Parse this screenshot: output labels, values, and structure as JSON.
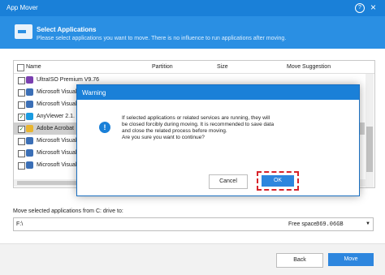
{
  "window": {
    "title": "App Mover",
    "help_label": "?",
    "close_label": "×"
  },
  "header": {
    "title": "Select Applications",
    "subtitle": "Please select applications you want to move. There is no influence to run applications after moving."
  },
  "table": {
    "columns": [
      "Name",
      "Partition",
      "Size",
      "Move Suggestion"
    ],
    "rows": [
      {
        "name": "UltraISO Premium V9.76",
        "checked": false,
        "icon_color": "#7a3fb0"
      },
      {
        "name": "Microsoft Visual",
        "checked": false,
        "icon_color": "#3b6fb6"
      },
      {
        "name": "Microsoft Visual",
        "checked": false,
        "icon_color": "#3b6fb6"
      },
      {
        "name": "AnyViewer 2.1.",
        "checked": true,
        "icon_color": "#1a9be0"
      },
      {
        "name": "Adobe Acrobat",
        "checked": true,
        "icon_color": "#e8b530",
        "selected": true
      },
      {
        "name": "Microsoft Visual",
        "checked": false,
        "icon_color": "#3b6fb6"
      },
      {
        "name": "Microsoft Visual",
        "checked": false,
        "icon_color": "#3b6fb6"
      },
      {
        "name": "Microsoft Visual",
        "checked": false,
        "icon_color": "#3b6fb6"
      }
    ]
  },
  "drive": {
    "label": "Move selected applications from C: drive to:",
    "path": "F:\\",
    "free_label": "Free space:",
    "free_value": "369.06GB"
  },
  "footer": {
    "back_label": "Back",
    "move_label": "Move"
  },
  "dialog": {
    "title": "Warning",
    "icon_label": "!",
    "line1": "If selected applications or related services are running, they will",
    "line2": "be closed forcibly during moving. It is recommended to save data",
    "line3": "and close the related process before moving.",
    "line4": "Are you sure you want to continue?",
    "cancel_label": "Cancel",
    "ok_label": "OK"
  },
  "colors": {
    "accent": "#1a80d8",
    "highlight": "#d8232a"
  }
}
